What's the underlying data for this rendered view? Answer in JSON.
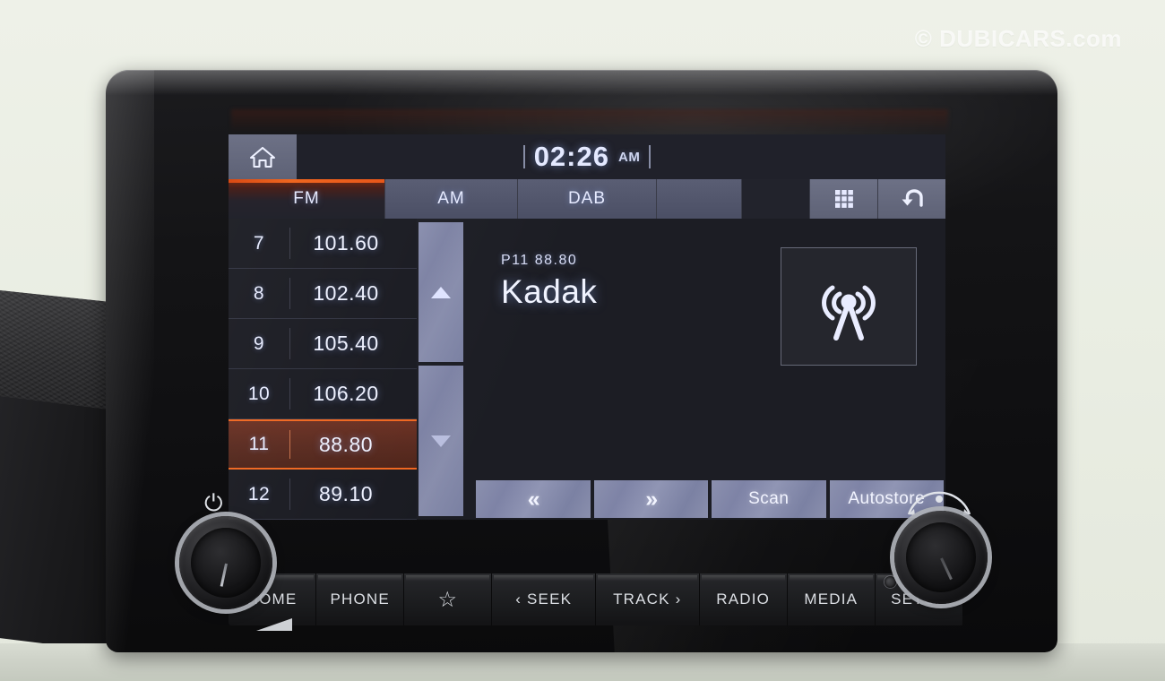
{
  "watermark": "© DUBICARS.com",
  "screen": {
    "status": {
      "home_icon": "home-icon",
      "time": "02:26",
      "ampm": "AM"
    },
    "tabs": [
      {
        "label": "FM",
        "active": true
      },
      {
        "label": "AM",
        "active": false
      },
      {
        "label": "DAB",
        "active": false
      }
    ],
    "top_right_buttons": [
      {
        "name": "apps-grid-button",
        "icon": "grid-icon"
      },
      {
        "name": "back-button",
        "icon": "back-arrow-icon"
      }
    ],
    "presets": {
      "columns": [
        "number",
        "frequency"
      ],
      "rows": [
        {
          "number": "7",
          "frequency": "101.60",
          "selected": false
        },
        {
          "number": "8",
          "frequency": "102.40",
          "selected": false
        },
        {
          "number": "9",
          "frequency": "105.40",
          "selected": false
        },
        {
          "number": "10",
          "frequency": "106.20",
          "selected": false
        },
        {
          "number": "11",
          "frequency": "88.80",
          "selected": true
        },
        {
          "number": "12",
          "frequency": "89.10",
          "selected": false
        }
      ]
    },
    "scroll": {
      "up_label": "▲",
      "down_label": "▼"
    },
    "station": {
      "preset_and_frequency": "P11  88.80",
      "name": "Kadak",
      "source_icon": "radio-tower-icon"
    },
    "soft_buttons": [
      {
        "name": "tune-down-button",
        "label": "«"
      },
      {
        "name": "tune-up-button",
        "label": "»"
      },
      {
        "name": "scan-button",
        "label": "Scan"
      },
      {
        "name": "autostore-button",
        "label": "Autostore"
      }
    ],
    "colors": {
      "accent_orange": "#f0661f",
      "screen_bg": "#1c1d24",
      "button_slate": "#8a8fae",
      "text_blue_white": "#eef1ff"
    }
  },
  "hardware_buttons": [
    {
      "name": "home-hardkey",
      "label": "HOME"
    },
    {
      "name": "phone-hardkey",
      "label": "PHONE"
    },
    {
      "name": "favorite-hardkey",
      "label": "☆"
    },
    {
      "name": "seek-hardkey",
      "label": "‹ SEEK"
    },
    {
      "name": "track-hardkey",
      "label": "TRACK ›"
    },
    {
      "name": "radio-hardkey",
      "label": "RADIO"
    },
    {
      "name": "media-hardkey",
      "label": "MEDIA"
    },
    {
      "name": "setup-hardkey",
      "label": "SETUP"
    }
  ],
  "knobs": {
    "left": {
      "name": "power-volume-knob",
      "glyph": "⏻"
    },
    "right": {
      "name": "tune-knob"
    }
  }
}
